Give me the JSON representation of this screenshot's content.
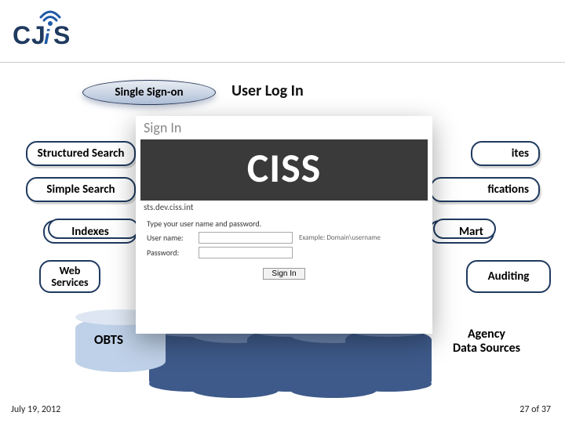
{
  "logo_text": "CJiS",
  "sso_label": "Single Sign-on",
  "user_login_label": "User Log In",
  "pills": {
    "structured_search": "Structured Search",
    "simple_search": "Simple Search",
    "indexes": "Indexes",
    "web_services": "Web\nServices",
    "right_partial_1": "ites",
    "right_partial_2": "fications",
    "right_partial_3": "Mart",
    "auditing": "Auditing"
  },
  "obts_label": "OBTS",
  "agency_label": "Agency\nData Sources",
  "modal": {
    "signin": "Sign In",
    "ciss": "CISS",
    "domain": "sts.dev.ciss.int",
    "prompt": "Type your user name and password.",
    "username_label": "User name:",
    "password_label": "Password:",
    "example": "Example: Domain\\username",
    "signin_btn": "Sign In"
  },
  "footer": {
    "date": "July 19, 2012",
    "page": "27 of 37"
  }
}
